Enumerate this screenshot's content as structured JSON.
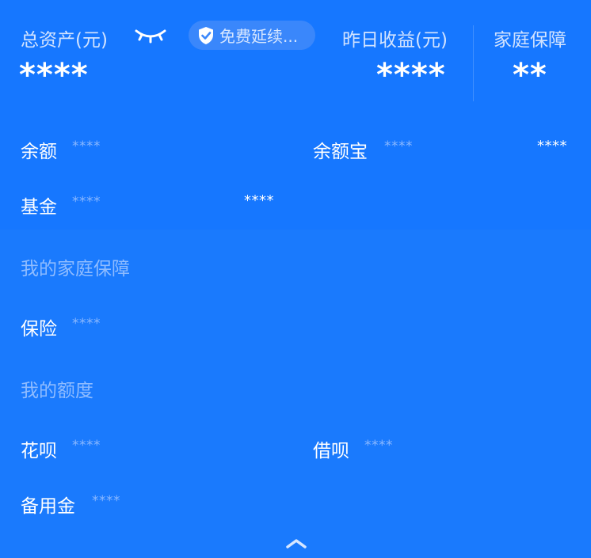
{
  "header": {
    "total_assets_label": "总资产(元)",
    "total_assets_value": "****",
    "promo_label": "免费延续...",
    "yesterday_income_label": "昨日收益(元)",
    "yesterday_income_value": "****",
    "family_protection_label": "家庭保障",
    "family_protection_value": "**"
  },
  "assets": {
    "balance_label": "余额",
    "balance_value": "****",
    "yuebao_label": "余额宝",
    "yuebao_value": "****",
    "yuebao_income": "****",
    "fund_label": "基金",
    "fund_value": "****",
    "fund_income": "****"
  },
  "protection_section": {
    "title": "我的家庭保障",
    "insurance_label": "保险",
    "insurance_value": "****"
  },
  "credit_section": {
    "title": "我的额度",
    "huabei_label": "花呗",
    "huabei_value": "****",
    "jiebei_label": "借呗",
    "jiebei_value": "****",
    "reserve_label": "备用金",
    "reserve_value": "****"
  },
  "icons": {
    "hide_toggle": "eye-closed-icon",
    "shield": "shield-check-icon",
    "collapse": "chevron-up-icon"
  },
  "colors": {
    "background": "#1677ff",
    "text_primary": "#ffffff",
    "text_muted": "#8ab8ff"
  }
}
